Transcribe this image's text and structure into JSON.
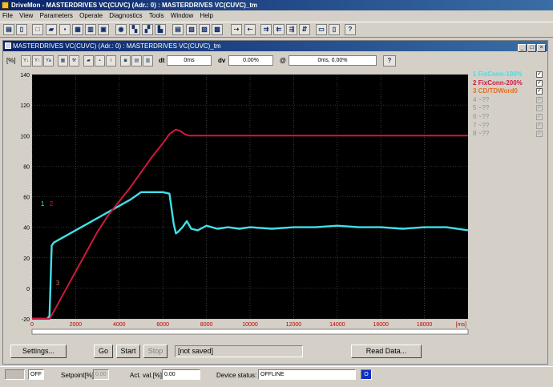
{
  "app": {
    "title": "DriveMon - MASTERDRIVES VC(CUVC)  (Adr.: 0) : MASTERDRIVES VC(CUVC)_tm",
    "menu": [
      "File",
      "View",
      "Parameters",
      "Operate",
      "Diagnostics",
      "Tools",
      "Window",
      "Help"
    ]
  },
  "child_window": {
    "title": "MASTERDRIVES VC(CUVC)  (Adr.: 0) : MASTERDRIVES VC(CUVC)_tm",
    "unit_label": "[%]",
    "dt_label": "dt",
    "dt_value": "0ms",
    "dv_label": "dv",
    "dv_value": "0.00%",
    "at_label": "@",
    "at_value": "0ms, 0.00%",
    "help_btn": "?"
  },
  "chart_data": {
    "type": "line",
    "xlabel": "[ms]",
    "xlim": [
      0,
      20000
    ],
    "ylim": [
      -20,
      140
    ],
    "xticks": [
      0,
      2000,
      4000,
      6000,
      8000,
      10000,
      12000,
      14000,
      16000,
      18000
    ],
    "yticks": [
      -20,
      0,
      20,
      40,
      60,
      80,
      100,
      120,
      140
    ],
    "grid": true,
    "background": "#000000",
    "series": [
      {
        "name": "FixConn-100%",
        "color": "#40e0e8",
        "x": [
          0,
          700,
          800,
          900,
          1000,
          1500,
          2000,
          2500,
          3000,
          3500,
          4000,
          4500,
          4800,
          5000,
          5500,
          6000,
          6300,
          6500,
          6600,
          6700,
          6900,
          7100,
          7300,
          7600,
          8000,
          8500,
          9000,
          9500,
          10000,
          11000,
          12000,
          13000,
          14000,
          15000,
          16000,
          17000,
          18000,
          19000,
          20000
        ],
        "y": [
          -20,
          -20,
          -18,
          28,
          30,
          34,
          38,
          42,
          46,
          50,
          54,
          58,
          61,
          63,
          63,
          63,
          62,
          42,
          36,
          37,
          40,
          44,
          39,
          38,
          41,
          39,
          40,
          39,
          40,
          39,
          40,
          40,
          41,
          40,
          40,
          39,
          40,
          40,
          38
        ]
      },
      {
        "name": "FixConn-200%",
        "color": "#d01840",
        "x": [
          0,
          500,
          800,
          1000,
          1500,
          2000,
          2500,
          3000,
          3500,
          4000,
          4500,
          5000,
          5500,
          6000,
          6300,
          6600,
          6800,
          7000,
          7200,
          8000,
          10000,
          12000,
          14000,
          16000,
          18000,
          20000
        ],
        "y": [
          -20,
          -20,
          -20,
          -15,
          -2,
          11,
          24,
          37,
          48,
          57,
          66,
          76,
          86,
          95,
          101,
          104,
          103,
          101,
          100,
          100,
          100,
          100,
          100,
          100,
          100,
          100
        ]
      },
      {
        "name": "CD/TDWord0",
        "color": "#e07020",
        "x": [],
        "y": []
      }
    ],
    "annotations": [
      {
        "text": "1",
        "color": "#40e0e8",
        "x": 400,
        "y": 54
      },
      {
        "text": "2",
        "color": "#d01840",
        "x": 800,
        "y": 54
      },
      {
        "text": "3",
        "color": "#e07020",
        "x": 1100,
        "y": 2
      }
    ]
  },
  "legend": [
    {
      "index": "1",
      "name": "FixConn-100%",
      "color": "#40e0e8",
      "checked": true,
      "dim": false
    },
    {
      "index": "2",
      "name": "FixConn-200%",
      "color": "#d01840",
      "checked": true,
      "dim": false
    },
    {
      "index": "3",
      "name": "CD/TDWord0",
      "color": "#e07020",
      "checked": true,
      "dim": false
    },
    {
      "index": "4",
      "name": "~??",
      "color": "#909090",
      "checked": true,
      "dim": true
    },
    {
      "index": "5",
      "name": "~??",
      "color": "#909090",
      "checked": true,
      "dim": true
    },
    {
      "index": "6",
      "name": "~??",
      "color": "#909090",
      "checked": true,
      "dim": true
    },
    {
      "index": "7",
      "name": "~??",
      "color": "#909090",
      "checked": true,
      "dim": true
    },
    {
      "index": "8",
      "name": "~??",
      "color": "#909090",
      "checked": true,
      "dim": true
    }
  ],
  "buttons": {
    "settings": "Settings...",
    "go": "Go",
    "start": "Start",
    "stop": "Stop",
    "save_state": "[not saved]",
    "read_data": "Read Data..."
  },
  "statusbar": {
    "off": "OFF",
    "setpoint_label": "Setpoint[%]:",
    "setpoint_value": "0.00",
    "actval_label": "Act. val.[%]:",
    "actval_value": "0.00",
    "device_status_label": "Device status:",
    "device_status_value": "OFFLINE",
    "indicator": "O"
  }
}
